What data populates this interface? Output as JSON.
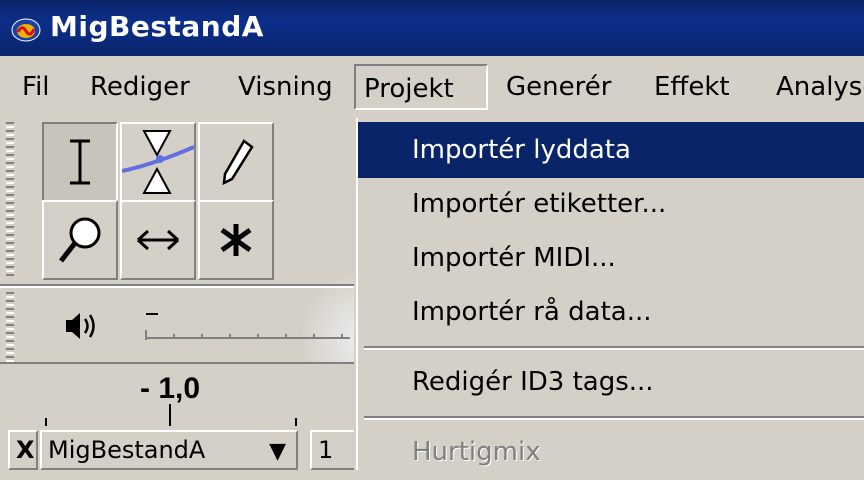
{
  "window": {
    "title": "MigBestandA"
  },
  "menubar": {
    "items": [
      "Fil",
      "Rediger",
      "Visning",
      "Projekt",
      "Generér",
      "Effekt",
      "Analyse"
    ]
  },
  "dropdown": {
    "items": [
      {
        "label": "Importér lyddata",
        "highlighted": true
      },
      {
        "label": "Importér etiketter..."
      },
      {
        "label": "Importér MIDI..."
      },
      {
        "label": "Importér rå data..."
      },
      {
        "label": "Redigér ID3 tags..."
      },
      {
        "label": "Hurtigmix",
        "disabled": true
      }
    ]
  },
  "toolbar": {
    "tools": [
      "selection-tool-icon",
      "envelope-tool-icon",
      "draw-tool-icon",
      "zoom-tool-icon",
      "timeshift-tool-icon",
      "multi-tool-icon"
    ]
  },
  "ruler": {
    "label": "- 1,0"
  },
  "track": {
    "close_label": "X",
    "name": "MigBestandA",
    "extra": "1"
  },
  "colors": {
    "titlebar": "#0a246a",
    "highlight": "#0a246a",
    "face": "#d4d0c8"
  }
}
